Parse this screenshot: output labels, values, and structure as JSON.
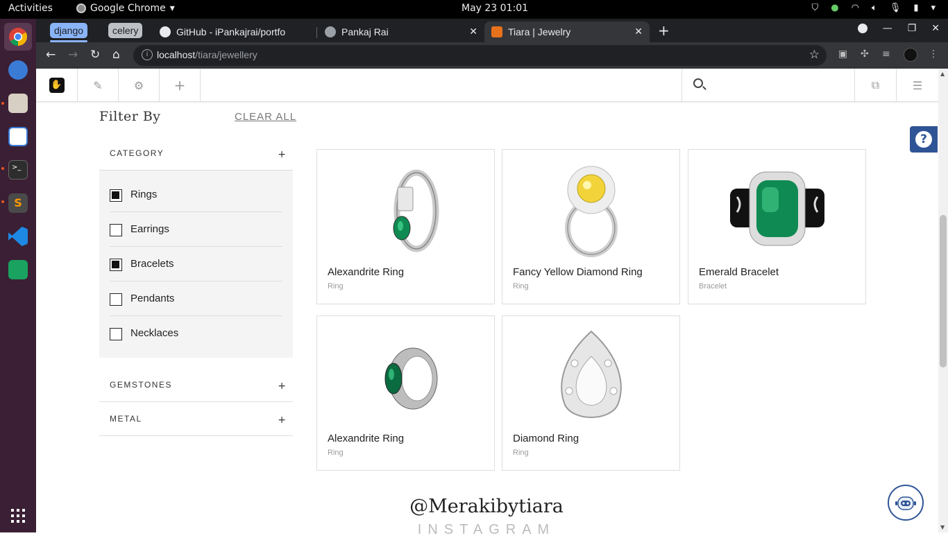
{
  "system_bar": {
    "activities": "Activities",
    "app_name": "Google Chrome",
    "clock": "May 23  01:01"
  },
  "browser": {
    "groups": [
      {
        "label": "django",
        "color": "#8ab4f8"
      },
      {
        "label": "celery",
        "color": "#bdc1c6"
      }
    ],
    "tabs": [
      {
        "title": "GitHub - iPankajrai/portfo",
        "icon": "github-icon"
      },
      {
        "title": "Pankaj Rai",
        "icon": "globe-icon"
      },
      {
        "title": "Tiara | Jewelry",
        "icon": "tiara-favicon"
      }
    ],
    "url_host": "localhost",
    "url_path": "/tiara/jewellery"
  },
  "filters": {
    "title": "Filter By",
    "clear_all": "CLEAR ALL",
    "category_label": "CATEGORY",
    "categories": [
      {
        "name": "Rings",
        "checked": true
      },
      {
        "name": "Earrings",
        "checked": false
      },
      {
        "name": "Bracelets",
        "checked": true
      },
      {
        "name": "Pendants",
        "checked": false
      },
      {
        "name": "Necklaces",
        "checked": false
      }
    ],
    "gemstones_label": "GEMSTONES",
    "metal_label": "METAL",
    "expand_symbol": "+"
  },
  "products": [
    {
      "name": "Alexandrite Ring",
      "type": "Ring"
    },
    {
      "name": "Fancy Yellow Diamond Ring",
      "type": "Ring"
    },
    {
      "name": "Emerald Bracelet",
      "type": "Bracelet"
    },
    {
      "name": "Alexandrite Ring",
      "type": "Ring"
    },
    {
      "name": "Diamond Ring",
      "type": "Ring"
    }
  ],
  "instagram": {
    "handle": "@Merakibytiara",
    "label": "INSTAGRAM"
  },
  "colors": {
    "accent_blue": "#2f5496",
    "emerald": "#0f8a52",
    "yellow_diamond": "#f2d43a"
  }
}
